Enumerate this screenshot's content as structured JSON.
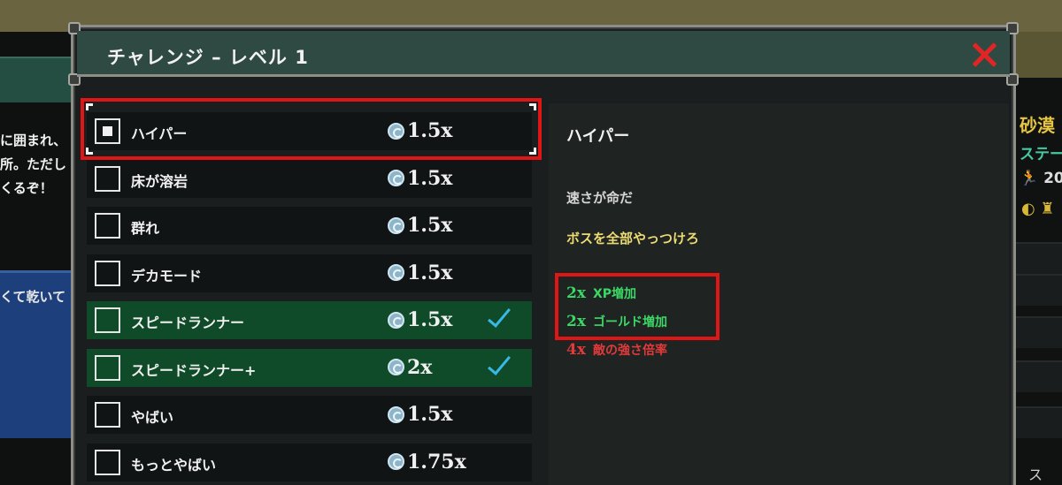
{
  "background": {
    "left_story_lines": [
      "に囲まれ、",
      "所。ただし",
      "くるぞ！"
    ],
    "left_panel_text": "くて乾いて",
    "right_title": "砂漠",
    "right_subtitle": "ステー",
    "right_stat": "🏃 20",
    "right_footer": "ス"
  },
  "modal": {
    "title": "チャレンジ – レベル 1",
    "close_icon": "close-x-icon"
  },
  "challenges": [
    {
      "label": "ハイパー",
      "multiplier": "1.5x",
      "selected": true,
      "completed": false
    },
    {
      "label": "床が溶岩",
      "multiplier": "1.5x",
      "selected": false,
      "completed": false
    },
    {
      "label": "群れ",
      "multiplier": "1.5x",
      "selected": false,
      "completed": false
    },
    {
      "label": "デカモード",
      "multiplier": "1.5x",
      "selected": false,
      "completed": false
    },
    {
      "label": "スピードランナー",
      "multiplier": "1.5x",
      "selected": false,
      "completed": true
    },
    {
      "label": "スピードランナー+",
      "multiplier": "2x",
      "selected": false,
      "completed": true
    },
    {
      "label": "やばい",
      "multiplier": "1.5x",
      "selected": false,
      "completed": false
    },
    {
      "label": "もっとやばい",
      "multiplier": "1.75x",
      "selected": false,
      "completed": false
    }
  ],
  "details": {
    "title": "ハイパー",
    "description": "速さが命だ",
    "goal": "ボスを全部やっつけろ",
    "bonuses": [
      {
        "value": "2x",
        "text": "XP増加",
        "color": "#3cd866"
      },
      {
        "value": "2x",
        "text": "ゴールド増加",
        "color": "#3cd866"
      },
      {
        "value": "4x",
        "text": "敵の強さ倍率",
        "color": "#e23a3a"
      }
    ]
  },
  "colors": {
    "completed_row": "#0f4a29",
    "highlight": "#e01616",
    "checkmark": "#38b9e6",
    "goal_text": "#ecdb72"
  }
}
